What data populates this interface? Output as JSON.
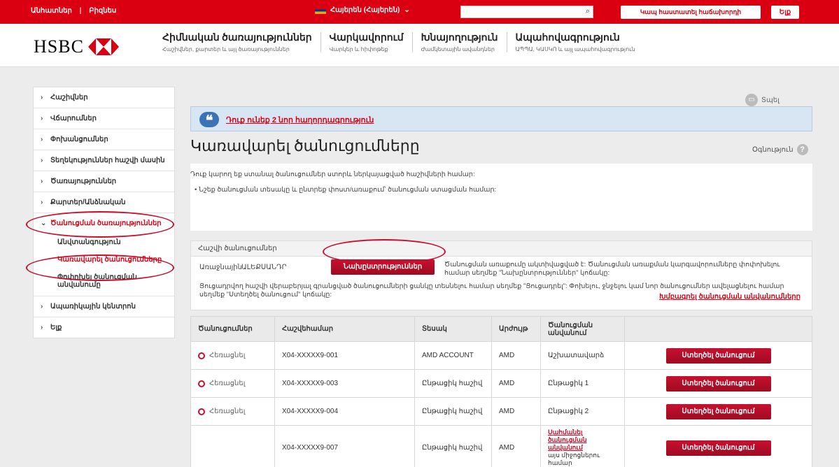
{
  "topbar": {
    "personal": "Անհատներ",
    "business": "Բիզնես",
    "language": "Հայերեն (Հայերեն)",
    "contact": "Կապ հաստատել հաճախորդի",
    "logout": "Ելք"
  },
  "header": {
    "brand": "HSBC",
    "nav": [
      {
        "title": "Հիմնական ծառայություններ",
        "sub": "Հաշիվներ, քարտեր և այլ ծառայություններ"
      },
      {
        "title": "Վարկավորում",
        "sub": "Վարկեր և հիփոթեք"
      },
      {
        "title": "Խնայողություն",
        "sub": "Ժամկետային ավանդներ"
      },
      {
        "title": "Ապահովագրություն",
        "sub": "ԱՊՊԱ, ԿԱՍԿՈ և այլ ապահովագրություն"
      }
    ]
  },
  "sidebar": {
    "items": [
      "Հաշիվներ",
      "Վճարումներ",
      "Փոխանցումներ",
      "Տեղեկություններ հաշվի մասին",
      "Ծառայություններ",
      "Քարտեր/Անձնական"
    ],
    "open_section": "Ծանուցման ծառայություններ",
    "subitems": [
      "Անվտանգություն",
      "Կառավարել ծանուցումները",
      "Փոփոխել ծանուցման անվանումը"
    ],
    "bottom_items": [
      "Ապառիկային կենտրոն",
      "Ելք"
    ]
  },
  "main": {
    "print": "Տպել",
    "alert_msg": "Դուք ունեք 2 նոր հաղորդագրություն",
    "title": "Կառավարել ծանուցումները",
    "help": "Օգնություն",
    "intro1": "Դուք կարող եք ստանալ ծանուցումներ ստորև ներկայացված հաշիվների համար:",
    "intro2": "• Նշեք ծանուցման տեսակը և ընտրեք փոստ/առաքում՝ ծանուցման ստացման համար:",
    "panel_header": "Հաշվի ծանուցումներ",
    "panel_label": "Առաջնային",
    "panel_value": "ԱԼԵՔՍԱՆԴՐ",
    "pref_button": "Նախընտրություններ",
    "panel_text1": "Ծանուցման առաքումը ակտիվացված է: Ծանուցման առաքման կարգավորումները փոփոխելու համար սեղմեք \"Նախընտրություններ\" կոճակը:",
    "panel_text2": "Ցուցադրվող հաշվի վերաբերյալ գրանցված ծանուցումների ցանկը տեսնելու համար սեղմեք \"Ցուցադրել\": Փոխելու, ջնջելու կամ նոր ծանուցումներ ավելացնելու համար սեղմեք \"Ստեղծել ծանուցում\" կոճակը:",
    "panel_link": "Խմբագրել ծանուցման անվանումները"
  },
  "table": {
    "headers": [
      "Ծանուցումներ",
      "Հաշվեհամար",
      "Տեսակ",
      "Արժույթ",
      "Ծանուցման անվանում",
      ""
    ],
    "delete_label": "Հեռացնել",
    "create_label": "Ստեղծել ծանուցում",
    "rows": [
      {
        "deletable": true,
        "account": "X04-XXXXX9-001",
        "type": "AMD ACCOUNT",
        "currency": "AMD",
        "name": "Աշխատավարձ",
        "name_link": false
      },
      {
        "deletable": true,
        "account": "X04-XXXXX9-003",
        "type": "Ընթացիկ հաշիվ",
        "currency": "AMD",
        "name": "Ընթացիկ 1",
        "name_link": false
      },
      {
        "deletable": true,
        "account": "X04-XXXXX9-004",
        "type": "Ընթացիկ հաշիվ",
        "currency": "AMD",
        "name": "Ընթացիկ 2",
        "name_link": false
      },
      {
        "deletable": false,
        "account": "X04-XXXXX9-007",
        "type": "Ընթացիկ հաշիվ",
        "currency": "AMD",
        "name": "Սահմանել ծանուցման անվանում",
        "name_note": "այս միջոցներու համար",
        "name_link": true
      }
    ]
  },
  "colors": {
    "brand_red": "#db0011",
    "alert_blue": "#d8e6f4"
  }
}
